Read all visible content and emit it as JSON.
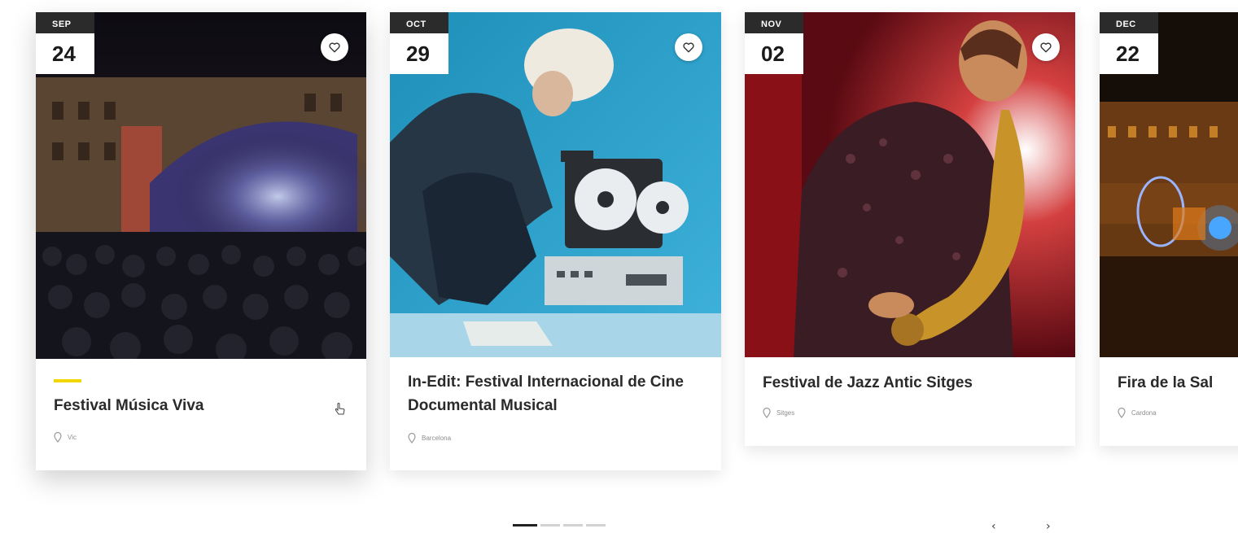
{
  "cards": [
    {
      "month": "SEP",
      "day": "24",
      "title": "Festival Música Viva",
      "location": "Vic",
      "active": true
    },
    {
      "month": "OCT",
      "day": "29",
      "title": "In-Edit: Festival Internacional de Cine Documental Musical",
      "location": "Barcelona",
      "active": false
    },
    {
      "month": "NOV",
      "day": "02",
      "title": "Festival de Jazz Antic Sitges",
      "location": "Sitges",
      "active": false
    },
    {
      "month": "DEC",
      "day": "22",
      "title": "Fira de la Sal",
      "location": "Cardona",
      "active": false
    }
  ],
  "icons": {
    "favorite": "heart-icon",
    "location": "location-pin-icon",
    "cursor": "hand-pointer-icon",
    "prev": "chevron-left-icon",
    "next": "chevron-right-icon"
  },
  "pager": {
    "total": 4,
    "current": 1
  },
  "nav": {
    "prev": "‹",
    "next": "›"
  },
  "colors": {
    "accent": "#f2d600",
    "badge_dark": "#2b2b2b",
    "title": "#2a2a2a"
  }
}
